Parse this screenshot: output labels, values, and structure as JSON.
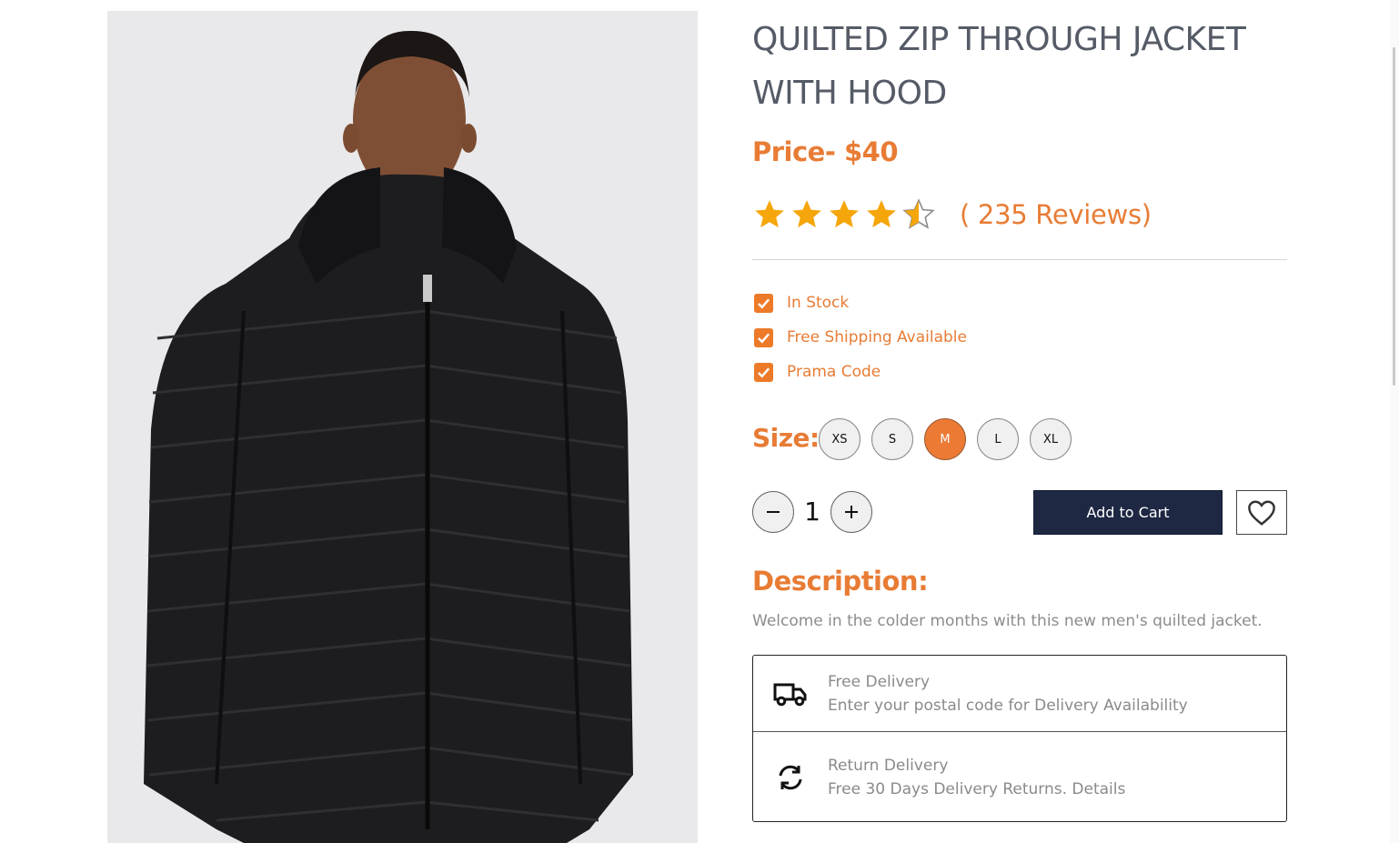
{
  "product": {
    "title": "QUILTED ZIP THROUGH JACKET WITH HOOD",
    "price": "Price- $40",
    "rating": {
      "value": 4.5,
      "max": 5,
      "reviews_text": "( 235 Reviews)"
    },
    "image_alt": "Man wearing black quilted zip through jacket with hood"
  },
  "features": [
    "In Stock",
    "Free Shipping Available",
    "Prama Code"
  ],
  "size": {
    "label": "Size:",
    "options": [
      "XS",
      "S",
      "M",
      "L",
      "XL"
    ],
    "selected": "M"
  },
  "quantity": {
    "value": "1"
  },
  "actions": {
    "add_to_cart": "Add to Cart"
  },
  "description": {
    "heading": "Description:",
    "text": "Welcome in the colder months with this new men's quilted jacket."
  },
  "delivery": [
    {
      "title": "Free Delivery",
      "subtitle": "Enter your postal code for Delivery Availability",
      "icon": "truck-icon"
    },
    {
      "title": "Return Delivery",
      "subtitle": "Free 30 Days Delivery Returns. Details",
      "icon": "refresh-icon"
    }
  ],
  "colors": {
    "accent": "#e87c35",
    "dark_button": "#1e2843",
    "title": "#555b66",
    "muted": "#8a8a8a"
  }
}
